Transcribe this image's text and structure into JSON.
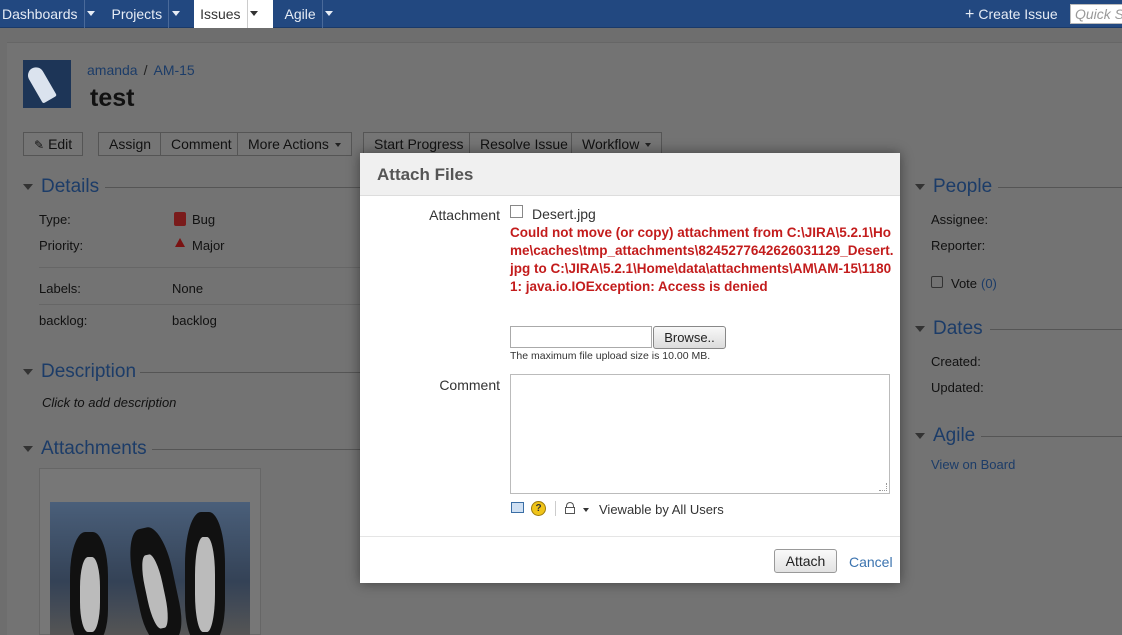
{
  "topnav": {
    "items": [
      {
        "label": "Dashboards"
      },
      {
        "label": "Projects"
      },
      {
        "label": "Issues"
      },
      {
        "label": "Agile"
      }
    ],
    "create_issue": "Create Issue",
    "quick_search_placeholder": "Quick S"
  },
  "issue": {
    "project": "amanda",
    "key": "AM-15",
    "title": "test"
  },
  "actions": {
    "edit": "Edit",
    "assign": "Assign",
    "comment": "Comment",
    "more_actions": "More Actions",
    "start_progress": "Start Progress",
    "resolve_issue": "Resolve Issue",
    "workflow": "Workflow"
  },
  "details": {
    "heading": "Details",
    "type_label": "Type:",
    "type_value": "Bug",
    "priority_label": "Priority:",
    "priority_value": "Major",
    "labels_label": "Labels:",
    "labels_value": "None",
    "backlog_label": "backlog:",
    "backlog_value": "backlog"
  },
  "description": {
    "heading": "Description",
    "placeholder": "Click to add description"
  },
  "attachments": {
    "heading": "Attachments"
  },
  "people": {
    "heading": "People",
    "assignee_label": "Assignee:",
    "reporter_label": "Reporter:",
    "vote_label": "Vote",
    "vote_count": "(0)"
  },
  "dates": {
    "heading": "Dates",
    "created_label": "Created:",
    "updated_label": "Updated:"
  },
  "agile": {
    "heading": "Agile",
    "view_on_board": "View on Board"
  },
  "modal": {
    "title": "Attach Files",
    "attachment_label": "Attachment",
    "file_name": "Desert.jpg",
    "error": "Could not move (or copy) attachment from C:\\JIRA\\5.2.1\\Home\\caches\\tmp_attachments\\8245277642626031129_Desert.jpg to C:\\JIRA\\5.2.1\\Home\\data\\attachments\\AM\\AM-15\\11801: java.io.IOException: Access is denied",
    "browse_label": "Browse..",
    "upload_hint": "The maximum file upload size is 10.00 MB.",
    "comment_label": "Comment",
    "help_glyph": "?",
    "viewable_by": "Viewable by All Users",
    "attach_button": "Attach",
    "cancel_link": "Cancel"
  }
}
